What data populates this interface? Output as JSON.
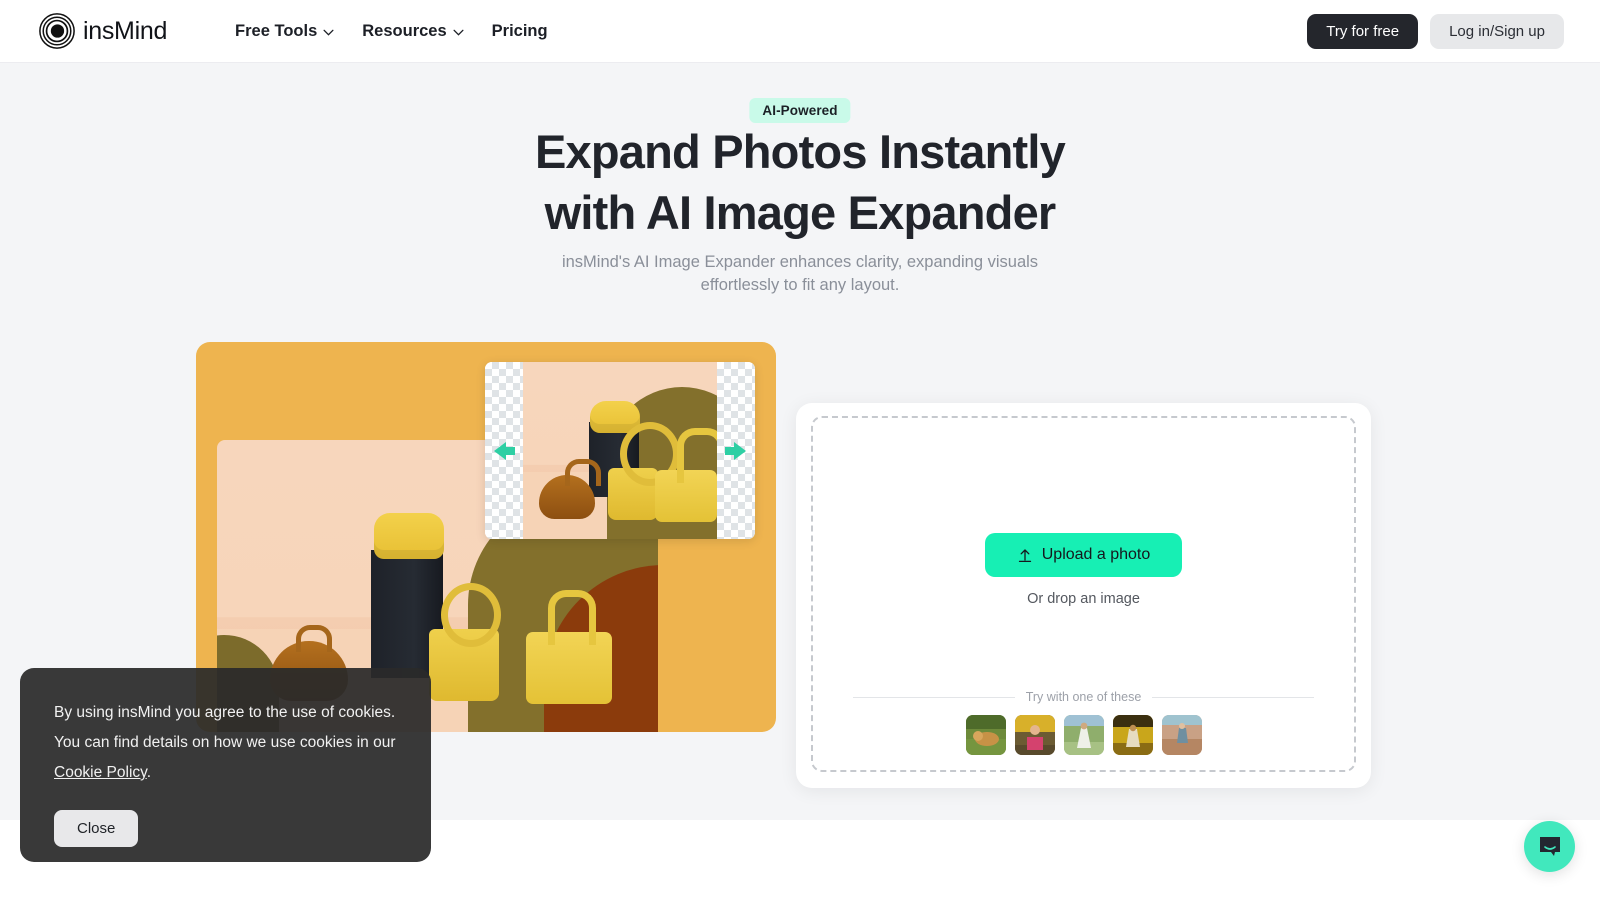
{
  "header": {
    "logo_text": "insMind",
    "logo_icon": "concentric-rings-logo",
    "nav": [
      {
        "label": "Free Tools",
        "has_chevron": true
      },
      {
        "label": "Resources",
        "has_chevron": true
      },
      {
        "label": "Pricing",
        "has_chevron": false
      }
    ],
    "try_free_label": "Try for free",
    "login_label": "Log in/Sign up"
  },
  "hero": {
    "badge": "AI-Powered",
    "title_line1": "Expand Photos Instantly",
    "title_line2": "with AI Image Expander",
    "subtitle": "insMind's AI Image Expander enhances clarity, expanding visuals effortlessly to fit any layout."
  },
  "showcase": {
    "frame_color": "#eeb44f",
    "arrow_color": "#2ecfa4",
    "left_arrow_icon": "arrow-left-icon",
    "right_arrow_icon": "arrow-right-icon",
    "photo_alt": "expanded product photo of yellow and brown handbags"
  },
  "upload": {
    "button_label": "Upload a photo",
    "button_icon": "upload-arrow-icon",
    "button_color": "#17efb4",
    "drop_hint": "Or drop an image",
    "try_label": "Try with one of these",
    "samples": [
      {
        "name": "golden-retriever-on-grass",
        "c1": "#6d8a3a",
        "c2": "#c08b3f",
        "c3": "#3f5d22"
      },
      {
        "name": "girl-with-tulips",
        "c1": "#d8b02a",
        "c2": "#d4426e",
        "c3": "#6b5b33"
      },
      {
        "name": "woman-in-white-dress-field",
        "c1": "#9fba7c",
        "c2": "#e6e8e0",
        "c3": "#6d8a52"
      },
      {
        "name": "child-in-yellow-flower-field",
        "c1": "#c9a61b",
        "c2": "#3b2f10",
        "c3": "#e0c45a"
      },
      {
        "name": "person-in-desert-landscape",
        "c1": "#c9a185",
        "c2": "#8fb6c4",
        "c3": "#a8724c"
      }
    ]
  },
  "cookie": {
    "text_before_link": "By using insMind you agree to the use of cookies. You can find details on how we use cookies in our ",
    "link_label": "Cookie Policy",
    "text_after_link": ".",
    "close_label": "Close"
  },
  "chat": {
    "icon": "chat-bubble-icon",
    "color": "#41e8bd"
  }
}
